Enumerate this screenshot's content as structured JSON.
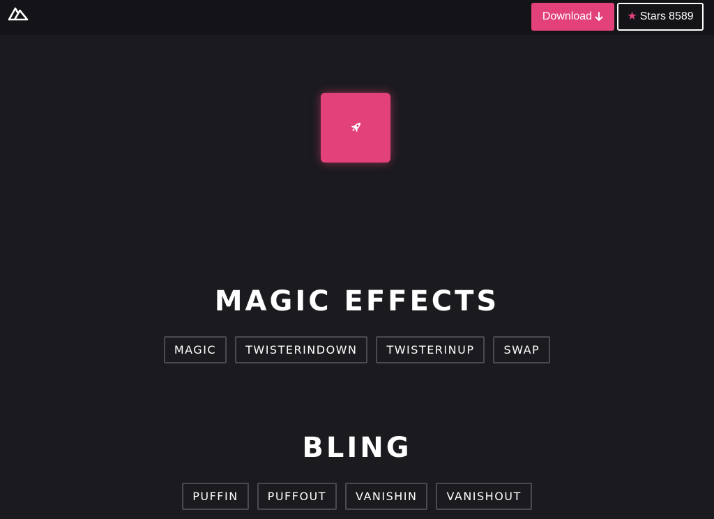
{
  "topbar": {
    "logo_icon": "nuxt-mountain-icon",
    "download_label": "Download",
    "download_icon": "arrow-down-icon",
    "stars_icon": "star-icon",
    "stars_label": "Stars",
    "stars_count": "8589"
  },
  "demo": {
    "icon": "rocket-icon",
    "color": "#e34179"
  },
  "sections": [
    {
      "title": "MAGIC EFFECTS",
      "buttons": [
        "MAGIC",
        "TWISTERINDOWN",
        "TWISTERINUP",
        "SWAP"
      ]
    },
    {
      "title": "BLING",
      "buttons": [
        "PUFFIN",
        "PUFFOUT",
        "VANISHIN",
        "VANISHOUT"
      ]
    }
  ],
  "colors": {
    "background": "#1a1a1f",
    "topbar": "#141418",
    "accent": "#e34179",
    "button_border": "#4a4a50"
  }
}
